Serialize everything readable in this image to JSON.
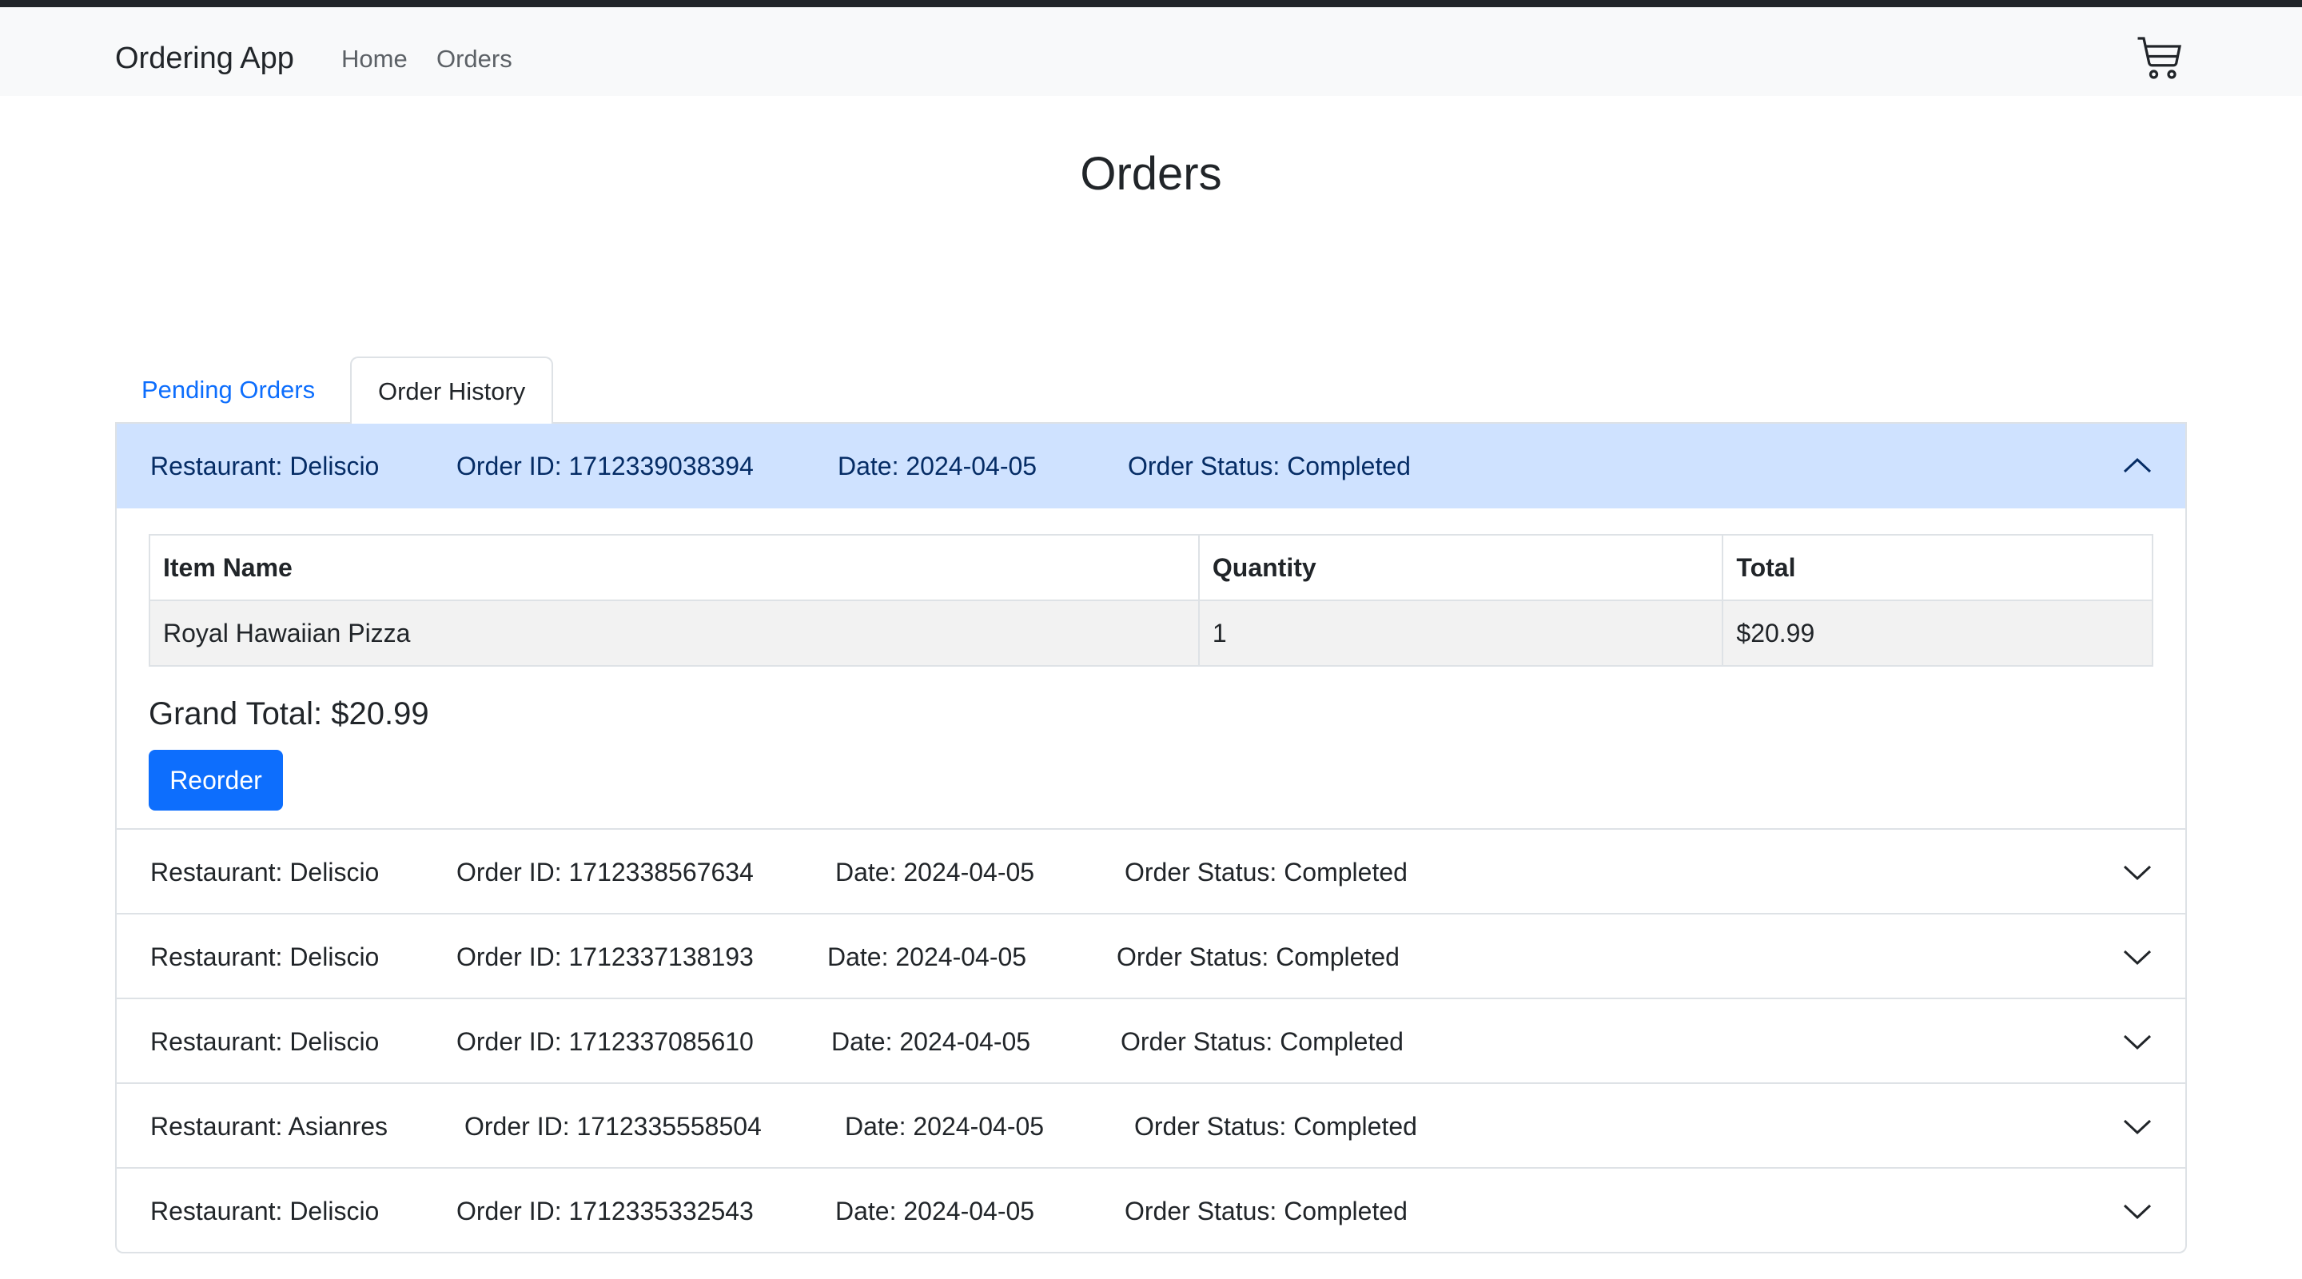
{
  "navbar": {
    "brand": "Ordering App",
    "links": [
      "Home",
      "Orders"
    ],
    "cart_icon": "cart-icon"
  },
  "page_title": "Orders",
  "tabs": [
    {
      "label": "Pending Orders",
      "active": false
    },
    {
      "label": "Order History",
      "active": true
    }
  ],
  "orders": [
    {
      "restaurant": "Restaurant: Deliscio",
      "order_id": "Order ID: 1712339038394",
      "date": "Date: 2024-04-05",
      "status": "Order Status: Completed",
      "expanded": true,
      "table_headers": [
        "Item Name",
        "Quantity",
        "Total"
      ],
      "items": [
        {
          "name": "Royal Hawaiian Pizza",
          "quantity": "1",
          "total": "$20.99"
        }
      ],
      "grand_total": "Grand Total: $20.99",
      "reorder_label": "Reorder"
    },
    {
      "restaurant": "Restaurant: Deliscio",
      "order_id": "Order ID: 1712338567634",
      "date": "Date: 2024-04-05",
      "status": "Order Status: Completed",
      "expanded": false
    },
    {
      "restaurant": "Restaurant: Deliscio",
      "order_id": "Order ID: 1712337138193",
      "date": "Date: 2024-04-05",
      "status": "Order Status: Completed",
      "expanded": false
    },
    {
      "restaurant": "Restaurant: Deliscio",
      "order_id": "Order ID: 1712337085610",
      "date": "Date: 2024-04-05",
      "status": "Order Status: Completed",
      "expanded": false
    },
    {
      "restaurant": "Restaurant: Asianres",
      "order_id": "Order ID: 1712335558504",
      "date": "Date: 2024-04-05",
      "status": "Order Status: Completed",
      "expanded": false
    },
    {
      "restaurant": "Restaurant: Deliscio",
      "order_id": "Order ID: 1712335332543",
      "date": "Date: 2024-04-05",
      "status": "Order Status: Completed",
      "expanded": false
    }
  ],
  "colors": {
    "accent": "#0d6efd",
    "expanded_header_bg": "#cfe2ff",
    "navbar_bg": "#f8f9fa"
  }
}
